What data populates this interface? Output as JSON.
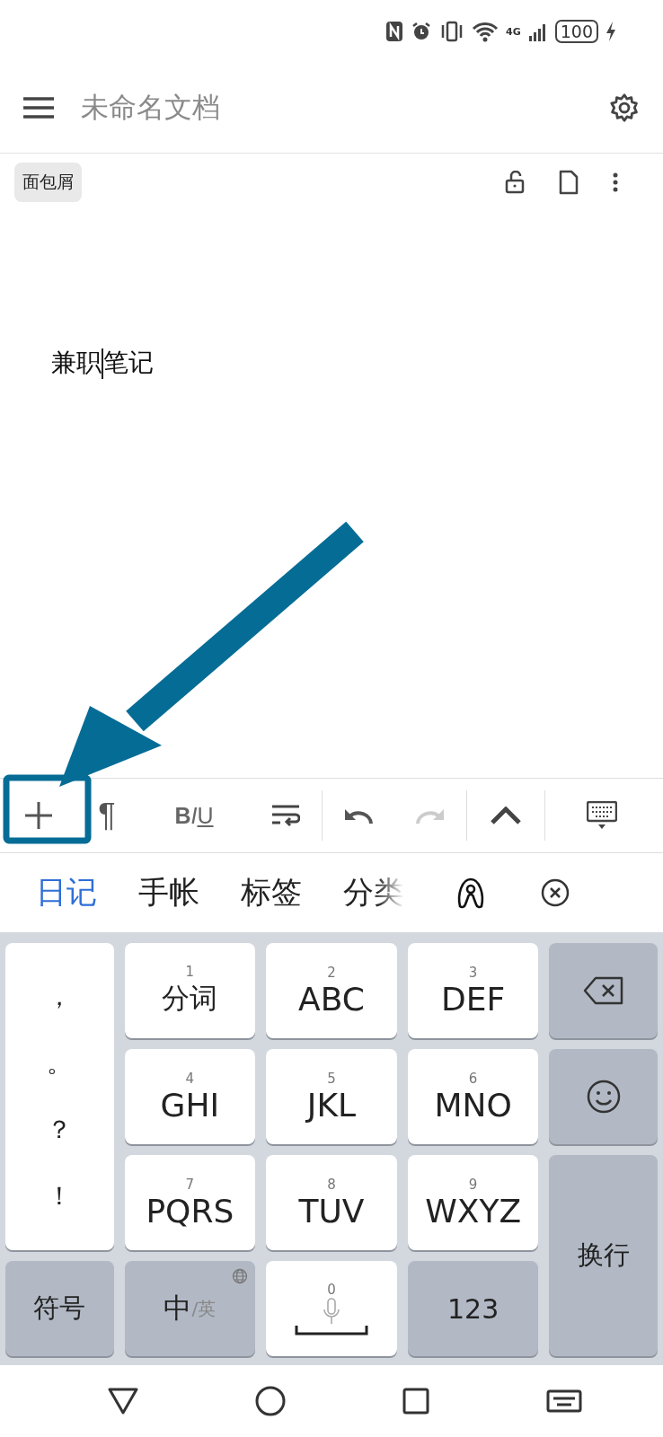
{
  "status_bar": {
    "network": "4G",
    "battery": "100",
    "charging": true
  },
  "header": {
    "title": "未命名文档"
  },
  "breadcrumb": {
    "label": "面包屑"
  },
  "document": {
    "text_before_cursor": "兼职",
    "text_after_cursor": "笔记"
  },
  "toolbar": {
    "paragraph": "¶",
    "format": [
      "B",
      "I",
      "U"
    ],
    "undo": {
      "disabled": false
    },
    "redo": {
      "disabled": true
    }
  },
  "suggestions": [
    {
      "label": "日记",
      "selected": true
    },
    {
      "label": "手帐",
      "selected": false
    },
    {
      "label": "标签",
      "selected": false
    },
    {
      "label": "分类",
      "selected": false
    }
  ],
  "keyboard": {
    "punctuation": [
      "，",
      "。",
      "？",
      "！"
    ],
    "keys": [
      {
        "digit": "1",
        "label": "分词"
      },
      {
        "digit": "2",
        "label": "ABC"
      },
      {
        "digit": "3",
        "label": "DEF"
      },
      {
        "digit": "4",
        "label": "GHI"
      },
      {
        "digit": "5",
        "label": "JKL"
      },
      {
        "digit": "6",
        "label": "MNO"
      },
      {
        "digit": "7",
        "label": "PQRS"
      },
      {
        "digit": "8",
        "label": "TUV"
      },
      {
        "digit": "9",
        "label": "WXYZ"
      }
    ],
    "symbols": "符号",
    "lang_main": "中",
    "lang_alt": "/英",
    "space_digit": "0",
    "numbers": "123",
    "enter": "换行"
  }
}
